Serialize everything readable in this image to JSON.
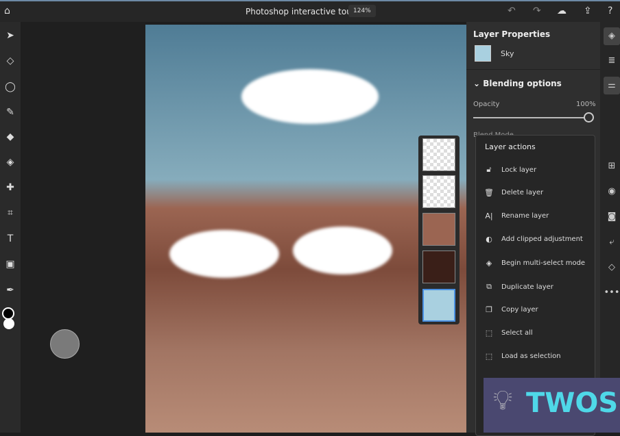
{
  "header": {
    "title": "Photoshop interactive tour",
    "zoom": "124%",
    "icons": [
      "home-icon",
      "undo-icon",
      "redo-icon",
      "cloud-icon",
      "share-icon",
      "help-icon"
    ]
  },
  "toolbar": {
    "tools": [
      "move-icon",
      "transform-icon",
      "lasso-icon",
      "brush-icon",
      "eraser-icon",
      "fill-icon",
      "healing-icon",
      "crop-icon",
      "type-icon",
      "image-icon",
      "eyedropper-icon"
    ],
    "foreground": "#000000",
    "background": "#ffffff"
  },
  "properties": {
    "title": "Layer Properties",
    "layer_name": "Sky",
    "section": "Blending options",
    "opacity_label": "Opacity",
    "opacity_value": "100%",
    "opacity": 100,
    "blend_label": "Blend Mode"
  },
  "menu": {
    "title": "Layer actions",
    "items": [
      {
        "label": "Lock layer",
        "icon": "lock-icon"
      },
      {
        "label": "Delete layer",
        "icon": "trash-icon"
      },
      {
        "label": "Rename layer",
        "icon": "rename-icon"
      },
      {
        "label": "Add clipped adjustment",
        "icon": "adjustment-icon"
      },
      {
        "label": "Begin multi-select mode",
        "icon": "layers-icon"
      },
      {
        "label": "Duplicate layer",
        "icon": "duplicate-icon"
      },
      {
        "label": "Copy layer",
        "icon": "copy-icon"
      },
      {
        "label": "Select all",
        "icon": "select-icon"
      },
      {
        "label": "Load as selection",
        "icon": "selection-icon"
      }
    ]
  },
  "watermark": {
    "text": "TWOS",
    "color": "#4fd8e8"
  }
}
